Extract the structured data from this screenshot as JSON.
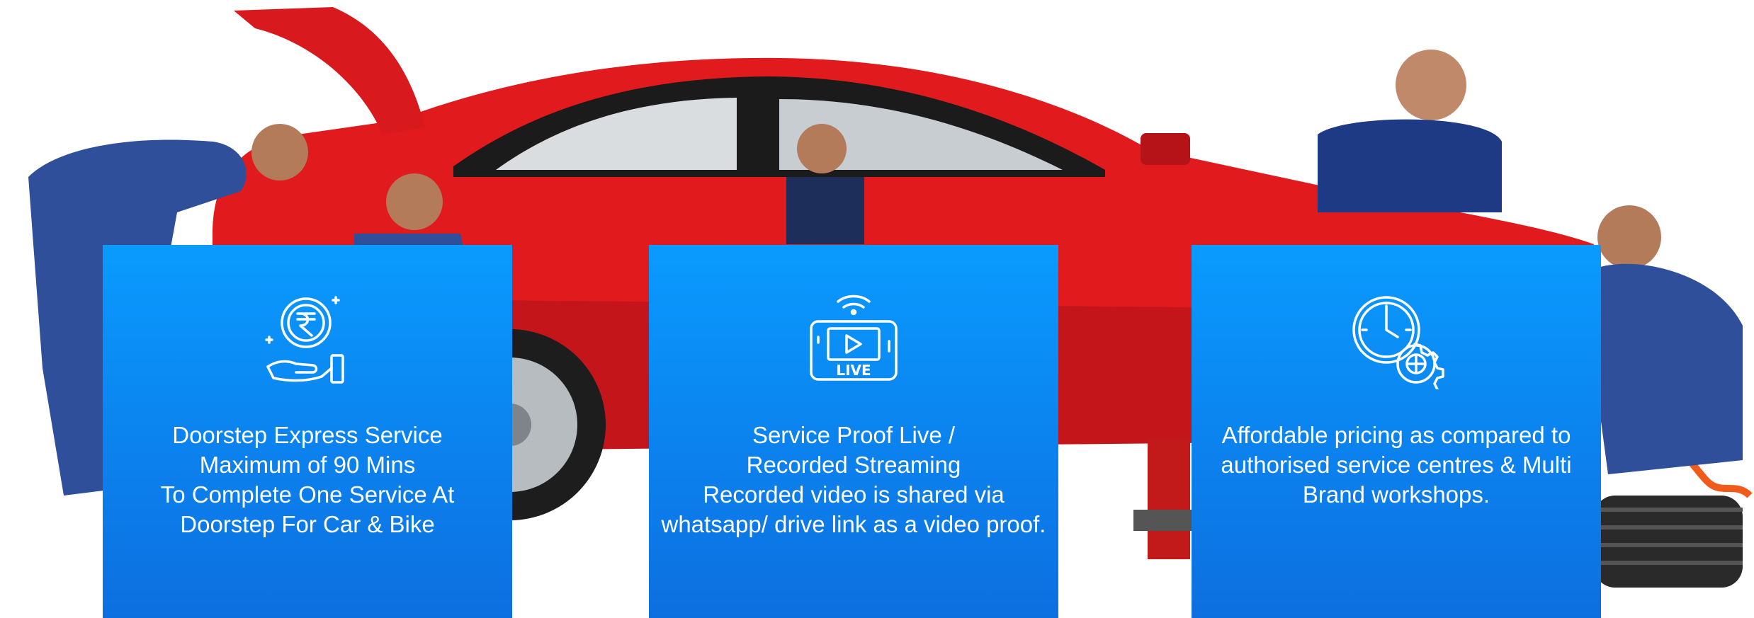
{
  "colors": {
    "card_top": "#0a9bff",
    "card_bottom": "#0d6fdf",
    "car_red": "#e01a1d",
    "uniform_blue": "#2f4f9a"
  },
  "cards": [
    {
      "icon": "rupee-hand-icon",
      "lines": [
        "Doorstep Express Service",
        "Maximum of 90 Mins",
        "To Complete One Service At",
        "Doorstep For Car & Bike"
      ]
    },
    {
      "icon": "live-stream-icon",
      "icon_label": "LIVE",
      "lines": [
        "Service Proof Live /",
        "Recorded Streaming",
        "Recorded video is shared via",
        "whatsapp/ drive link as a video proof."
      ]
    },
    {
      "icon": "clock-gear-icon",
      "lines": [
        "Affordable pricing as compared to",
        "authorised service centres & Multi",
        "Brand workshops."
      ]
    }
  ]
}
